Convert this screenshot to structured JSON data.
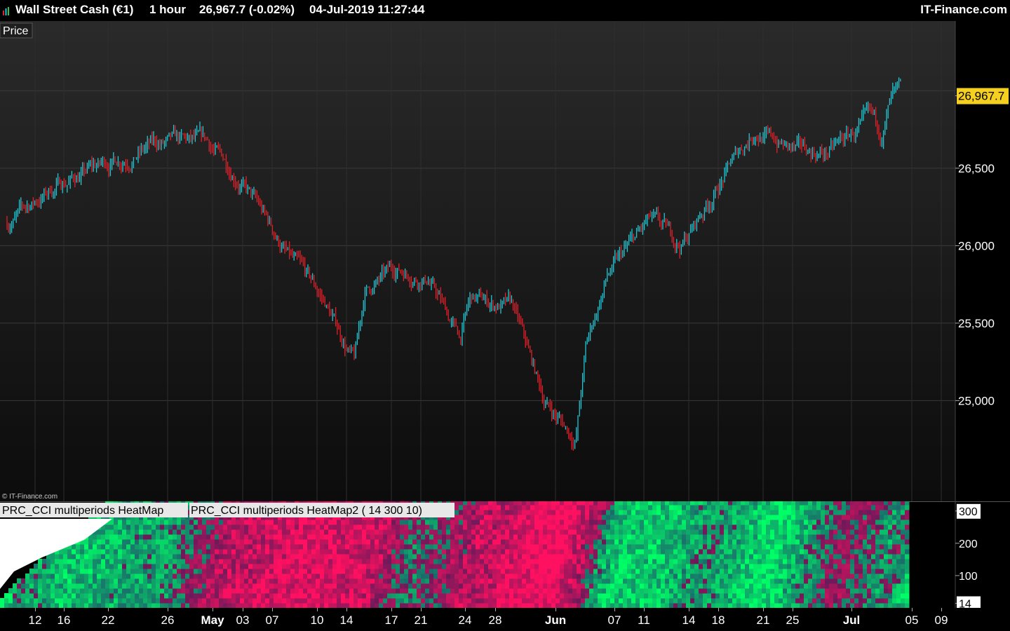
{
  "header": {
    "instrument": "Wall Street Cash (€1)",
    "timeframe": "1 hour",
    "quote": "26,967.7 (-0.02%)",
    "datetime": "04-Jul-2019 11:27:44",
    "brand": "IT-Finance.com"
  },
  "panels": {
    "price_label": "Price",
    "copyright": "© IT-Finance.com",
    "heatmap_label_1": "PRC_CCI multiperiods HeatMap",
    "heatmap_label_2": "PRC_CCI multiperiods HeatMap2 ( 14 300 10)"
  },
  "colors": {
    "bull_candle": "#1fc7d4",
    "bear_candle": "#e0202a",
    "last_price_tag": "#f5d020",
    "heat_green": "#00ff66",
    "heat_pink": "#ff1060",
    "heat_teal": "#1a6b6b",
    "heat_purple": "#6a1a5a"
  },
  "chart_data": [
    {
      "type": "line",
      "title": "Price",
      "y_ticks": [
        25000,
        25500,
        26000,
        26500
      ],
      "y_tick_labels": [
        "25,000",
        "25,500",
        "26,000",
        "26,500"
      ],
      "ylim": [
        24350,
        27450
      ],
      "last_price": 26967.7,
      "last_price_label": "26,967.7",
      "grid": true,
      "x_tick_labels": [
        "12",
        "16",
        "22",
        "26",
        "May",
        "03",
        "07",
        "10",
        "14",
        "17",
        "21",
        "24",
        "28",
        "Jun",
        "07",
        "11",
        "14",
        "18",
        "21",
        "25",
        "Jul",
        "05",
        "09"
      ],
      "x_tick_bold": [
        "May",
        "Jun",
        "Jul"
      ],
      "x": [
        "Apr-10",
        "Apr-15",
        "Apr-20",
        "Apr-24",
        "Apr-29",
        "May-02",
        "May-07",
        "May-10",
        "May-13",
        "May-14",
        "May-17",
        "May-20",
        "May-23",
        "May-24",
        "May-28",
        "May-31",
        "Jun-03",
        "Jun-04",
        "Jun-06",
        "Jun-10",
        "Jun-13",
        "Jun-14",
        "Jun-18",
        "Jun-20",
        "Jun-24",
        "Jun-27",
        "Jul-01",
        "Jul-02",
        "Jul-03",
        "Jul-04"
      ],
      "values": [
        26150,
        26400,
        26550,
        26650,
        26650,
        26450,
        25900,
        25650,
        25250,
        25700,
        25850,
        25800,
        25400,
        25650,
        25600,
        25000,
        24750,
        25350,
        25800,
        26150,
        26000,
        26100,
        26550,
        26750,
        26600,
        26600,
        26800,
        26700,
        26950,
        26967.7
      ]
    },
    {
      "type": "heatmap",
      "title": "PRC_CCI multiperiods HeatMap2 ( 14 300 10)",
      "y_ticks": [
        14,
        100,
        200,
        300
      ],
      "y_tick_labels": [
        "14",
        "100",
        "200",
        "300"
      ],
      "ylim": [
        0,
        330
      ],
      "columns": [
        {
          "x": "Apr-10",
          "bias": 0.2
        },
        {
          "x": "Apr-15",
          "bias": 0.6
        },
        {
          "x": "Apr-20",
          "bias": 0.4
        },
        {
          "x": "Apr-24",
          "bias": 0.3
        },
        {
          "x": "Apr-29",
          "bias": -0.5
        },
        {
          "x": "May-02",
          "bias": -0.6
        },
        {
          "x": "May-07",
          "bias": -0.8
        },
        {
          "x": "May-10",
          "bias": -0.7
        },
        {
          "x": "May-13",
          "bias": -0.7
        },
        {
          "x": "May-14",
          "bias": -0.5
        },
        {
          "x": "May-17",
          "bias": 0.1
        },
        {
          "x": "May-20",
          "bias": -0.2
        },
        {
          "x": "May-23",
          "bias": -0.6
        },
        {
          "x": "May-24",
          "bias": -0.5
        },
        {
          "x": "May-28",
          "bias": -0.9
        },
        {
          "x": "May-31",
          "bias": -1.0
        },
        {
          "x": "Jun-03",
          "bias": -0.2
        },
        {
          "x": "Jun-04",
          "bias": 0.4
        },
        {
          "x": "Jun-06",
          "bias": 0.7
        },
        {
          "x": "Jun-10",
          "bias": 0.6
        },
        {
          "x": "Jun-13",
          "bias": 0.3
        },
        {
          "x": "Jun-14",
          "bias": 0.2
        },
        {
          "x": "Jun-18",
          "bias": 0.6
        },
        {
          "x": "Jun-20",
          "bias": 0.9
        },
        {
          "x": "Jun-24",
          "bias": 0.2
        },
        {
          "x": "Jun-27",
          "bias": -0.3
        },
        {
          "x": "Jul-01",
          "bias": 0.3
        },
        {
          "x": "Jul-02",
          "bias": 0.0
        },
        {
          "x": "Jul-03",
          "bias": 0.5
        },
        {
          "x": "Jul-04",
          "bias": 0.8
        }
      ]
    }
  ]
}
